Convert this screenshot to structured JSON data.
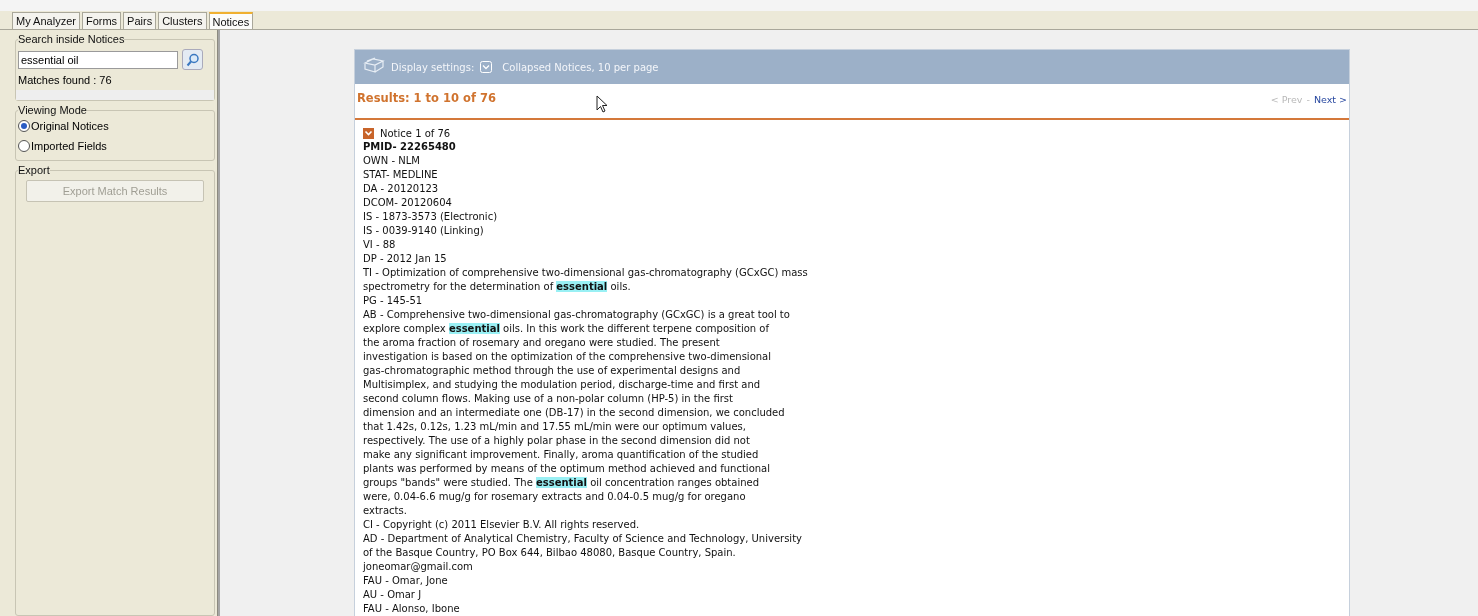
{
  "tabs": [
    {
      "label": "My Analyzer",
      "selected": false
    },
    {
      "label": "Forms",
      "selected": false
    },
    {
      "label": "Pairs",
      "selected": false
    },
    {
      "label": "Clusters",
      "selected": false
    },
    {
      "label": "Notices",
      "selected": true
    }
  ],
  "search": {
    "title": "Search inside Notices",
    "value": "essential oil",
    "matches": "Matches found : 76"
  },
  "viewing_mode": {
    "title": "Viewing Mode",
    "options": [
      {
        "label": "Original Notices",
        "selected": true
      },
      {
        "label": "Imported Fields",
        "selected": false
      }
    ]
  },
  "export": {
    "title": "Export",
    "button": {
      "label": "Export Match Results",
      "disabled": true
    }
  },
  "display_settings": {
    "label": "Display settings:",
    "value": "Collapsed Notices, 10 per page"
  },
  "results": {
    "summary": "Results: 1 to 10 of 76",
    "prev": {
      "label": "< Prev",
      "disabled": true
    },
    "separator": "-",
    "next": {
      "label": "Next >",
      "disabled": false
    }
  },
  "notice": {
    "header": "Notice 1 of 76",
    "lines": [
      {
        "text": "PMID- 22265480",
        "bold": true
      },
      {
        "text": "OWN - NLM",
        "bold": false
      },
      {
        "text": "STAT- MEDLINE",
        "bold": false
      },
      {
        "text": "DA - 20120123",
        "bold": false
      },
      {
        "text": "DCOM- 20120604",
        "bold": false
      },
      {
        "text": "IS - 1873-3573 (Electronic)",
        "bold": false
      },
      {
        "text": "IS - 0039-9140 (Linking)",
        "bold": false
      },
      {
        "text": "VI - 88",
        "bold": false
      },
      {
        "text": "DP - 2012 Jan 15",
        "bold": false
      },
      {
        "text": "TI - Optimization of comprehensive two-dimensional gas-chromatography (GCxGC) mass",
        "bold": false
      },
      {
        "text": "spectrometry for the determination of **essential** oils.",
        "bold": false
      },
      {
        "text": "PG - 145-51",
        "bold": false
      },
      {
        "text": "AB - Comprehensive two-dimensional gas-chromatography (GCxGC) is a great tool to",
        "bold": false
      },
      {
        "text": "explore complex **essential** oils. In this work the different terpene composition of",
        "bold": false
      },
      {
        "text": "the aroma fraction of rosemary and oregano were studied. The present",
        "bold": false
      },
      {
        "text": "investigation is based on the optimization of the comprehensive two-dimensional",
        "bold": false
      },
      {
        "text": "gas-chromatographic method through the use of experimental designs and",
        "bold": false
      },
      {
        "text": "Multisimplex, and studying the modulation period, discharge-time and first and",
        "bold": false
      },
      {
        "text": "second column flows. Making use of a non-polar column (HP-5) in the first",
        "bold": false
      },
      {
        "text": "dimension and an intermediate one (DB-17) in the second dimension, we concluded",
        "bold": false
      },
      {
        "text": "that 1.42s, 0.12s, 1.23 mL/min and 17.55 mL/min were our optimum values,",
        "bold": false
      },
      {
        "text": "respectively. The use of a highly polar phase in the second dimension did not",
        "bold": false
      },
      {
        "text": "make any significant improvement. Finally, aroma quantification of the studied",
        "bold": false
      },
      {
        "text": "plants was performed by means of the optimum method achieved and functional",
        "bold": false
      },
      {
        "text": "groups \"bands\" were studied. The **essential** oil concentration ranges obtained",
        "bold": false
      },
      {
        "text": "were, 0.04-6.6 mug/g for rosemary extracts and 0.04-0.5 mug/g for oregano",
        "bold": false
      },
      {
        "text": "extracts.",
        "bold": false
      },
      {
        "text": "CI - Copyright (c) 2011 Elsevier B.V. All rights reserved.",
        "bold": false
      },
      {
        "text": "AD - Department of Analytical Chemistry, Faculty of Science and Technology, University",
        "bold": false
      },
      {
        "text": "of the Basque Country, PO Box 644, Bilbao 48080, Basque Country, Spain.",
        "bold": false
      },
      {
        "text": "joneomar@gmail.com",
        "bold": false
      },
      {
        "text": "FAU - Omar, Jone",
        "bold": false
      },
      {
        "text": "AU - Omar J",
        "bold": false
      },
      {
        "text": "FAU - Alonso, Ibone",
        "bold": false
      }
    ]
  }
}
